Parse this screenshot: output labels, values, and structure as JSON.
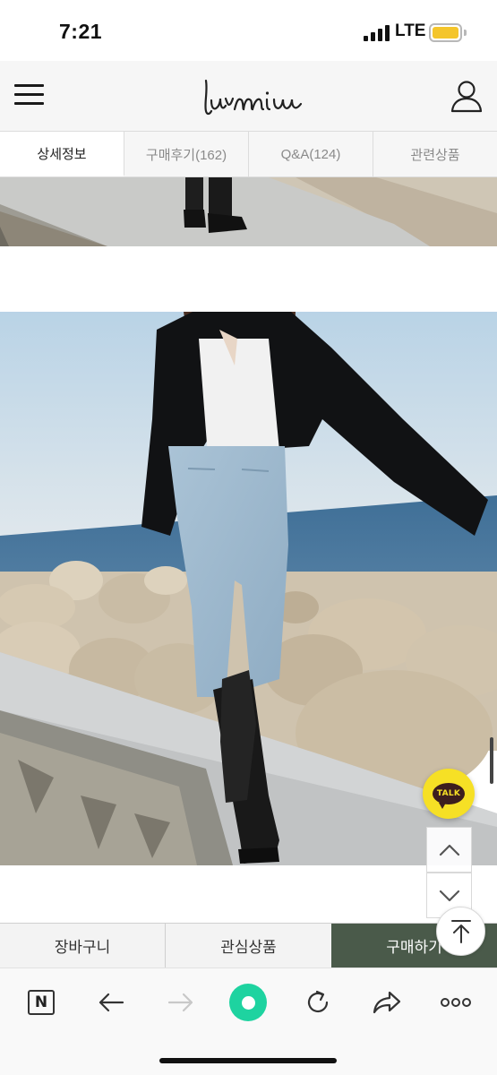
{
  "status_bar": {
    "time": "7:21",
    "network": "LTE",
    "battery_level": 1.0,
    "battery_color": "#f4c52b"
  },
  "header": {
    "logo_text": "luvmiu",
    "menu_icon": "hamburger-menu-icon",
    "account_icon": "user-icon"
  },
  "tabs": [
    {
      "label": "상세정보",
      "active": true
    },
    {
      "label": "구매후기(162)",
      "active": false
    },
    {
      "label": "Q&A(124)",
      "active": false
    },
    {
      "label": "관련상품",
      "active": false
    }
  ],
  "floating": {
    "talk_label": "TALK",
    "talk_color": "#f6e025",
    "up_icon": "chevron-up-icon",
    "down_icon": "chevron-down-icon",
    "top_icon": "scroll-top-icon"
  },
  "action_bar": {
    "cart_label": "장바구니",
    "wishlist_label": "관심상품",
    "buy_label": "구매하기",
    "buy_color": "#4a5a4a"
  },
  "browser_toolbar": {
    "naver_label": "N",
    "icons": [
      "naver-home-icon",
      "back-arrow-icon",
      "forward-arrow-icon",
      "green-dot-icon",
      "refresh-icon",
      "share-icon",
      "more-icon"
    ]
  }
}
